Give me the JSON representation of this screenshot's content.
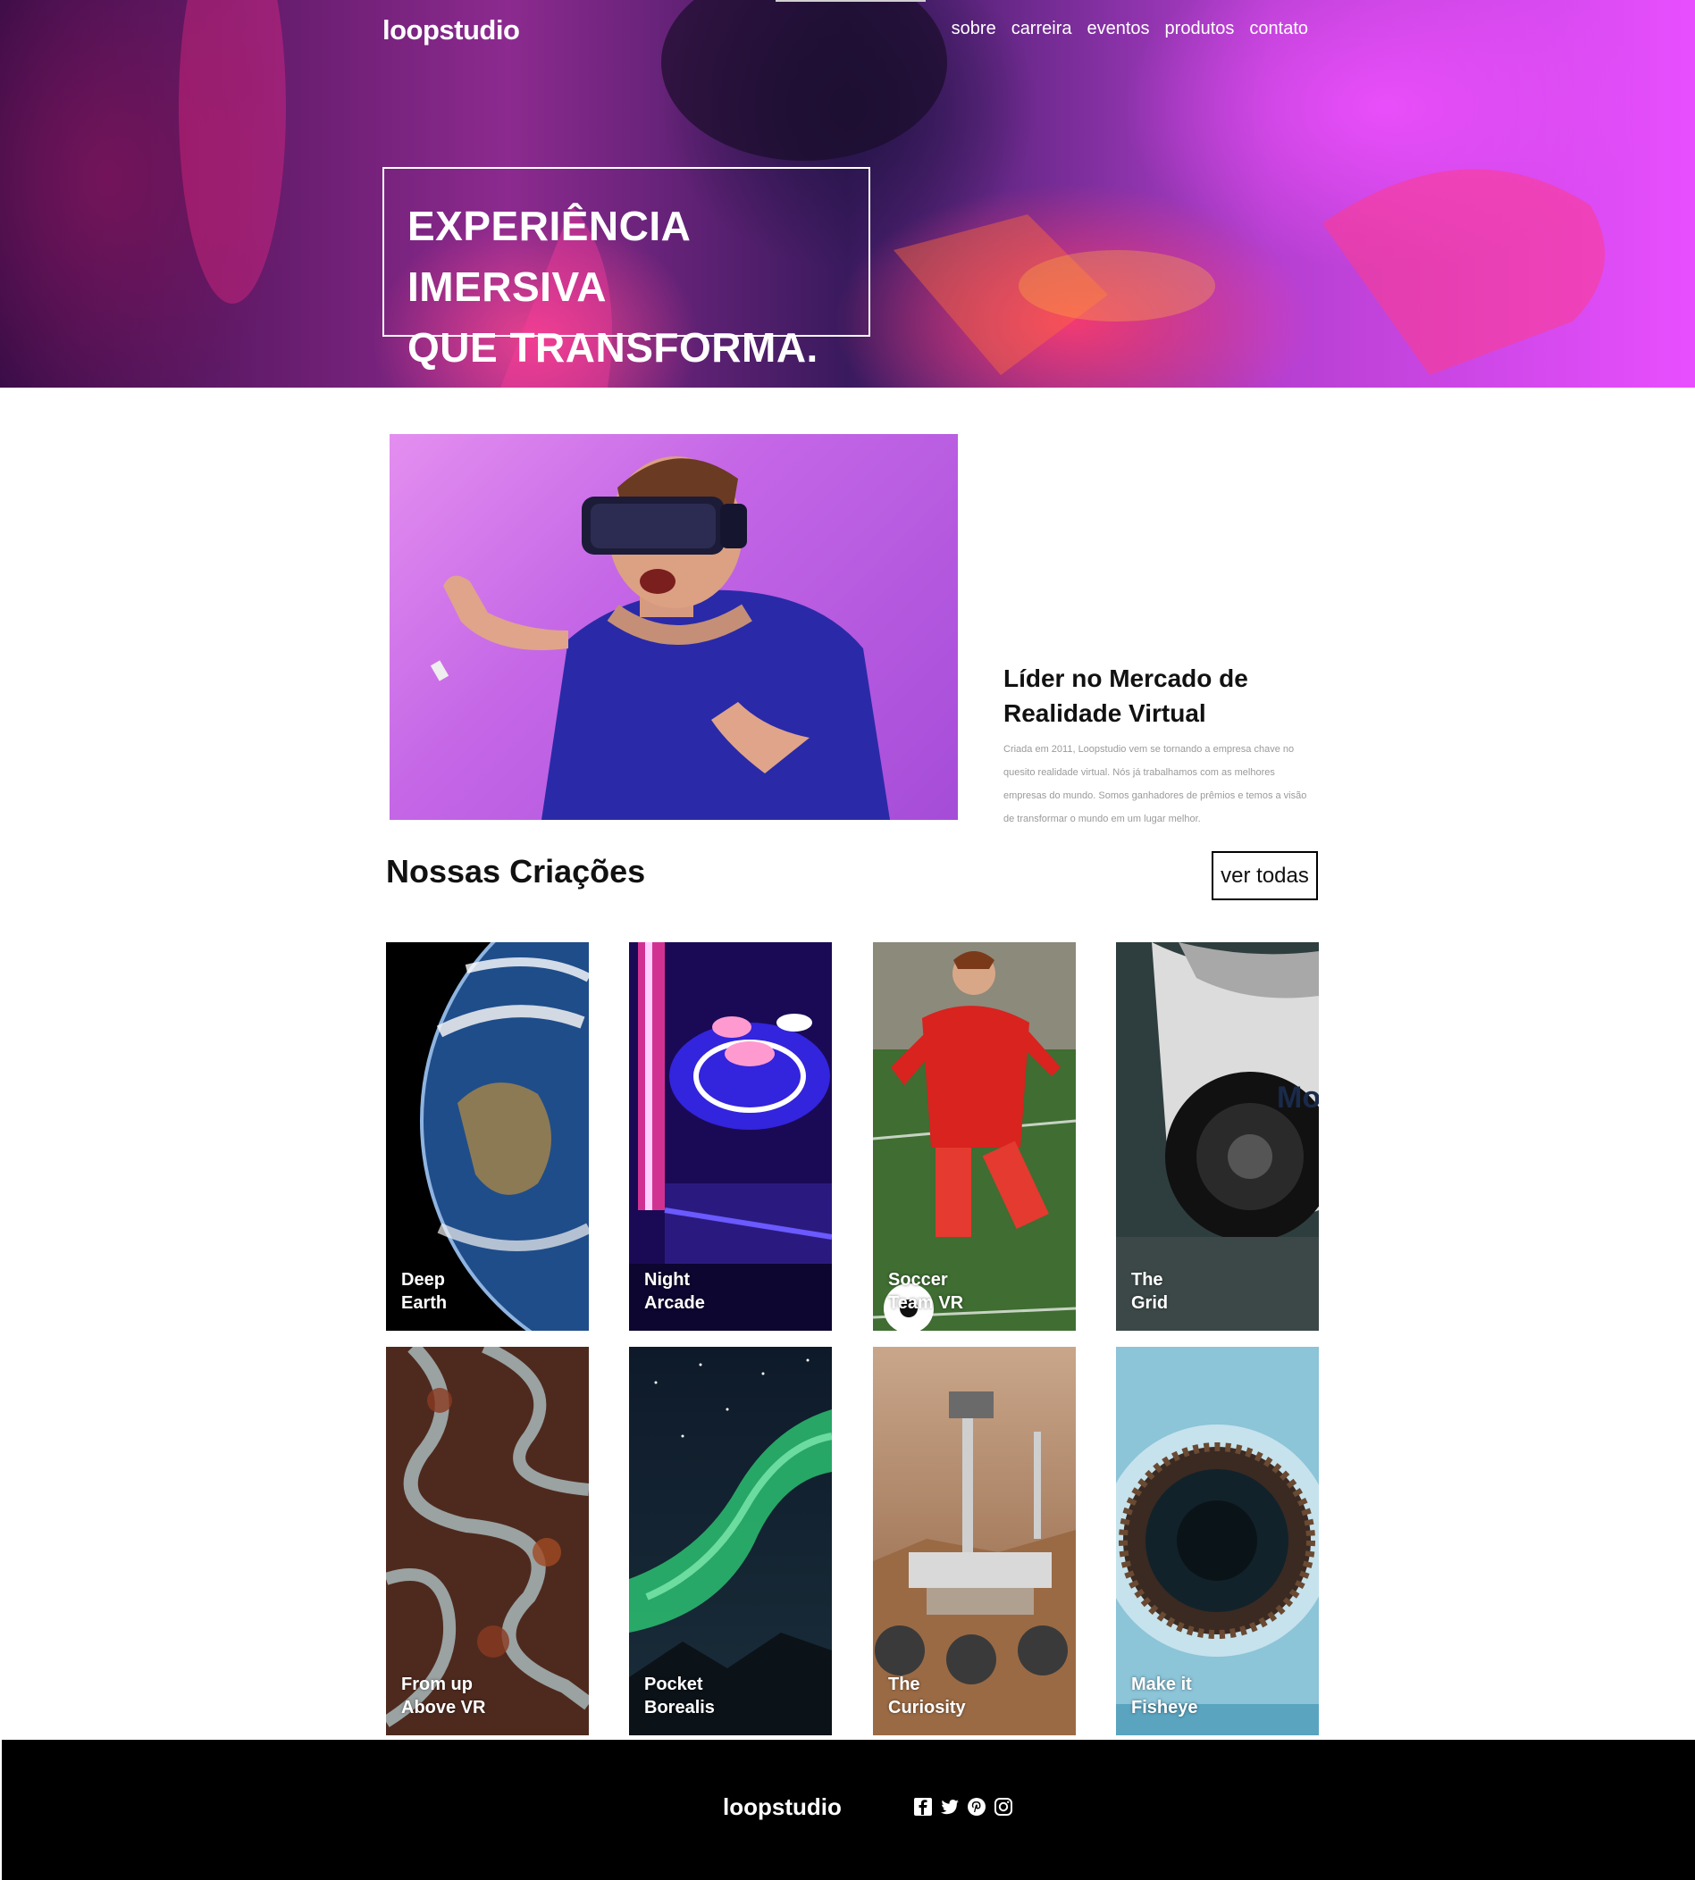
{
  "header": {
    "brand": "loopstudio",
    "nav": [
      "sobre",
      "carreira",
      "eventos",
      "produtos",
      "contato"
    ]
  },
  "hero": {
    "line1": "EXPERIÊNCIA IMERSIVA",
    "line2": "QUE TRANSFORMA."
  },
  "about": {
    "title_line1": "Líder no Mercado de",
    "title_line2": "Realidade Virtual",
    "body": "Criada em 2011, Loopstudio vem se tornando a empresa chave no quesito realidade virtual. Nós já trabalhamos com as melhores empresas do mundo. Somos ganhadores de prêmios e temos a visão de transformar o mundo em um lugar melhor."
  },
  "creations": {
    "title": "Nossas Criações",
    "see_all": "ver todas",
    "items": [
      {
        "label": "Deep\nEarth"
      },
      {
        "label": "Night\nArcade"
      },
      {
        "label": "Soccer\nTeam VR"
      },
      {
        "label": "The\nGrid"
      },
      {
        "label": "From up\nAbove VR"
      },
      {
        "label": "Pocket\nBorealis"
      },
      {
        "label": "The\nCuriosity"
      },
      {
        "label": "Make it\nFisheye"
      }
    ]
  },
  "footer": {
    "brand": "loopstudio",
    "social": [
      "facebook-icon",
      "twitter-icon",
      "pinterest-icon",
      "instagram-icon"
    ]
  }
}
